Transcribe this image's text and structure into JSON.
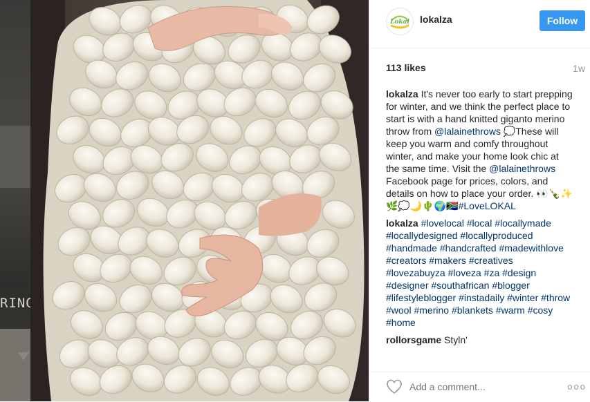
{
  "background": {
    "partial_text": "RINGS"
  },
  "post": {
    "username": "lokalza",
    "avatar_text": "Lokal",
    "follow_label": "Follow",
    "likes": "113 likes",
    "time_ago": "1w",
    "caption": {
      "author": "lokalza",
      "parts": [
        {
          "t": "text",
          "v": " It's never too early to start prepping for winter, and we think the perfect place to start is with a hand knitted giganto merino throw from "
        },
        {
          "t": "mention",
          "v": "@lalainethrows"
        },
        {
          "t": "text",
          "v": " 💭These will keep you warm and comfy throughout winter, and make your home look chic at the same time. Visit the "
        },
        {
          "t": "mention",
          "v": "@lalainethrows"
        },
        {
          "t": "text",
          "v": " Facebook page for prices, colors, and details on how to place your order. 👀🍾✨🌿💭🌙🌵🌍🇿🇦"
        },
        {
          "t": "tag",
          "v": "#LoveLOKAL"
        }
      ]
    },
    "hashtag_comment": {
      "author": "lokalza",
      "tags": [
        "#lovelocal",
        "#local",
        "#locallymade",
        "#locallydesigned",
        "#locallyproduced",
        "#handmade",
        "#handcrafted",
        "#madewithlove",
        "#creators",
        "#makers",
        "#creatives",
        "#lovezabuyza",
        "#loveza",
        "#za",
        "#design",
        "#designer",
        "#southafrican",
        "#blogger",
        "#lifestyleblogger",
        "#instadaily",
        "#winter",
        "#throw",
        "#wool",
        "#merino",
        "#blankets",
        "#warm",
        "#cosy",
        "#home"
      ]
    },
    "reply_comment": {
      "author": "rollorsgame",
      "text": "Styln'"
    },
    "add_comment_placeholder": "Add a comment...",
    "more_label": "ooo",
    "colors": {
      "accent": "#3897f0",
      "link": "#003569"
    }
  }
}
